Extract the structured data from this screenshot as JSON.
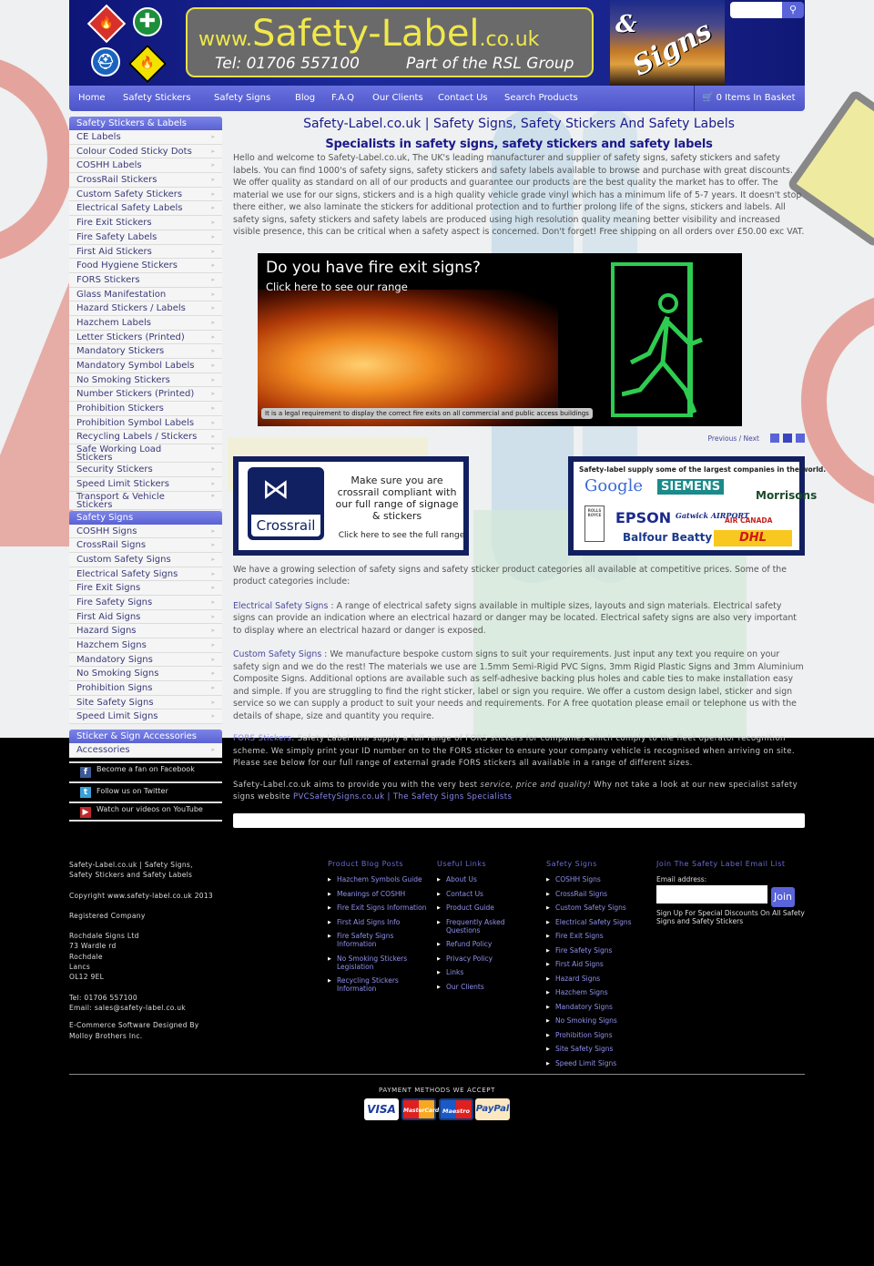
{
  "header": {
    "logo_url_prefix": "www.",
    "logo_url_main": "Safety-Label",
    "logo_url_suffix": ".co.uk",
    "telephone": "Tel: 01706 557100",
    "group": "Part of the RSL Group",
    "signs_amp": "&",
    "signs_word": "Signs",
    "search_placeholder": "",
    "search_icon": "search-icon"
  },
  "nav": {
    "items": [
      "Home",
      "Safety Stickers",
      "Safety Signs",
      "Blog",
      "F.A.Q",
      "Our Clients",
      "Contact Us",
      "Search Products"
    ],
    "basket": "0 Items In Basket",
    "basket_icon": "cart-icon"
  },
  "sidebar": {
    "stickers_heading": "Safety Stickers & Labels",
    "stickers": [
      "CE Labels",
      "Colour Coded Sticky Dots",
      "COSHH Labels",
      "CrossRail Stickers",
      "Custom Safety Stickers",
      "Electrical Safety Labels",
      "Fire Exit Stickers",
      "Fire Safety Labels",
      "First Aid Stickers",
      "Food Hygiene Stickers",
      "FORS Stickers",
      "Glass Manifestation",
      "Hazard Stickers / Labels",
      "Hazchem Labels",
      "Letter Stickers (Printed)",
      "Mandatory Stickers",
      "Mandatory Symbol Labels",
      "No Smoking Stickers",
      "Number Stickers (Printed)",
      "Prohibition Stickers",
      "Prohibition Symbol Labels",
      "Recycling Labels / Stickers",
      "Safe Working Load Stickers",
      "Security Stickers",
      "Speed Limit Stickers",
      "Transport & Vehicle Stickers"
    ],
    "signs_heading": "Safety Signs",
    "signs": [
      "COSHH Signs",
      "CrossRail Signs",
      "Custom Safety Signs",
      "Electrical Safety Signs",
      "Fire Exit Signs",
      "Fire Safety Signs",
      "First Aid Signs",
      "Hazard Signs",
      "Hazchem Signs",
      "Mandatory Signs",
      "No Smoking Signs",
      "Prohibition Signs",
      "Site Safety Signs",
      "Speed Limit Signs"
    ],
    "accessories_heading": "Sticker & Sign Accessories",
    "accessories": [
      "Accessories"
    ],
    "social": [
      {
        "icon": "facebook-icon",
        "label": "Become a fan on Facebook"
      },
      {
        "icon": "twitter-icon",
        "label": "Follow us on Twitter"
      },
      {
        "icon": "youtube-icon",
        "label": "Watch our videos on YouTube"
      }
    ]
  },
  "main": {
    "title": "Safety-Label.co.uk | Safety Signs, Safety Stickers And Safety Labels",
    "subtitle": "Specialists in safety signs, safety stickers and safety labels",
    "intro": "Hello and welcome to Safety-Label.co.uk, The UK's leading manufacturer and supplier of safety signs, safety stickers and safety labels. You can find 1000's of safety signs, safety stickers and safety labels available to browse and purchase with great discounts. We offer quality as standard on all of our products and guarantee our products are the best quality the market has to offer. The material we use for our signs, stickers and is a high quality vehicle grade vinyl which has a minimum life of 5-7 years. It doesn't stop there either, we also laminate the stickers for additional protection and to further prolong life of the signs, stickers and labels. All safety signs, safety stickers and safety labels are produced using high resolution quality meaning better visibility and increased visible presence, this can be critical when a safety aspect is concerned. Don't forget! Free shipping on all orders over £50.00 exc VAT.",
    "banner": {
      "heading": "Do you have fire exit signs?",
      "subheading": "Click here to see our range",
      "caption": "It is a legal requirement to display the correct fire exits on all commercial and public access buildings"
    },
    "pager": {
      "label": "Previous / Next",
      "slides": 3
    },
    "crossrail_promo": {
      "logo_word": "Crossrail",
      "text": "Make sure you are crossrail compliant with our full range of signage & stickers",
      "link": "Click here to see the full range"
    },
    "clients_promo": {
      "heading": "Safety-label supply some of the largest companies in the world.",
      "clients": [
        "Google",
        "SIEMENS",
        "Morrisons",
        "ROLLS ROYCE",
        "EPSON",
        "Gatwick AIRPORT",
        "AIR CANADA",
        "Balfour Beatty",
        "DHL"
      ]
    },
    "categories_intro": "We have a growing selection of safety signs and safety sticker product categories all available at competitive prices. Some of the product categories include:",
    "electrical_link": "Electrical Safety Signs",
    "electrical_text": " : A range of electrical safety signs available in multiple sizes, layouts and sign materials. Electrical safety signs can provide an indication where an electrical hazard or danger may be located. Electrical safety signs are also very important to display where an electrical hazard or danger is exposed.",
    "custom_link": "Custom Safety Signs",
    "custom_text": " : We manufacture bespoke custom signs to suit your requirements. Just input any text you require on your safety sign and we do the rest! The materials we use are 1.5mm Semi-Rigid PVC Signs, 3mm Rigid Plastic Signs and 3mm Aluminium Composite Signs. Additional options are available such as self-adhesive backing plus holes and cable ties to make installation easy and simple. If you are struggling to find the right sticker, label or sign you require. We offer a custom design label, sticker and sign service so we can supply a product to suit your needs and requirements. For A free quotation please email or telephone us with the details of shape, size and quantity you require.",
    "fors_link": "FORS Stickers",
    "fors_text": ": Safety Label now supply a full range of FORS stickers for companies which comply to the fleet operator recognition scheme. We simply print your ID number on to the FORS sticker to ensure your company vehicle is recognised when arriving on site. Please see below for our full range of external grade FORS stickers all available in a range of different sizes.",
    "aims_text": "Safety-Label.co.uk aims to provide you with the very best ",
    "aims_em": "service, price and quality!",
    "aims_text2": " Why not take a look at our new specialist safety signs website ",
    "pvc_link": "PVCSafetySigns.co.uk | The Safety Signs Specialists"
  },
  "footer": {
    "about": {
      "title": "Safety-Label.co.uk | Safety Signs, Safety Stickers and Safety Labels",
      "copyright": "Copyright www.safety-label.co.uk 2013",
      "registered": "Registered Company",
      "address": [
        "Rochdale Signs Ltd",
        "73 Wardle rd",
        "Rochdale",
        "Lancs",
        "OL12 9EL"
      ],
      "tel": "Tel: 01706 557100",
      "email": "Email: sales@safety-label.co.uk",
      "credit": "E-Commerce Software Designed By Molloy Brothers Inc."
    },
    "guides": {
      "heading": "Product Blog Posts",
      "items": [
        "Hazchem Symbols Guide",
        "Meanings of COSHH",
        "Fire Exit Signs Information",
        "First Aid Signs Info",
        "Fire Safety Signs Information",
        "No Smoking Stickers Legislation",
        "Recycling Stickers Information"
      ]
    },
    "useful": {
      "heading": "Useful Links",
      "items": [
        "About Us",
        "Contact Us",
        "Product Guide",
        "Frequently Asked Questions",
        "Refund Policy",
        "Privacy Policy",
        "Links",
        "Our Clients"
      ]
    },
    "signs": {
      "heading": "Safety Signs",
      "items": [
        "COSHH Signs",
        "CrossRail Signs",
        "Custom Safety Signs",
        "Electrical Safety Signs",
        "Fire Exit Signs",
        "Fire Safety Signs",
        "First Aid Signs",
        "Hazard Signs",
        "Hazchem Signs",
        "Mandatory Signs",
        "No Smoking Signs",
        "Prohibition Signs",
        "Site Safety Signs",
        "Speed Limit Signs"
      ]
    },
    "newsletter": {
      "heading": "Join The Safety Label Email List",
      "email_label": "Email address:",
      "email_value": "",
      "join": "Join",
      "signup_text": "Sign Up For Special Discounts On All Safety Signs and Safety Stickers"
    },
    "payment": {
      "title": "PAYMENT METHODS WE ACCEPT",
      "cards": [
        "VISA",
        "MasterCard",
        "Maestro",
        "PayPal"
      ]
    }
  },
  "colors": {
    "brand_navy": "#1a2690",
    "nav_purple": "#5a62d4",
    "logo_yellow": "#f0e84a",
    "link_blue": "#4a4aa0",
    "title_navy": "#1a1a8a"
  }
}
